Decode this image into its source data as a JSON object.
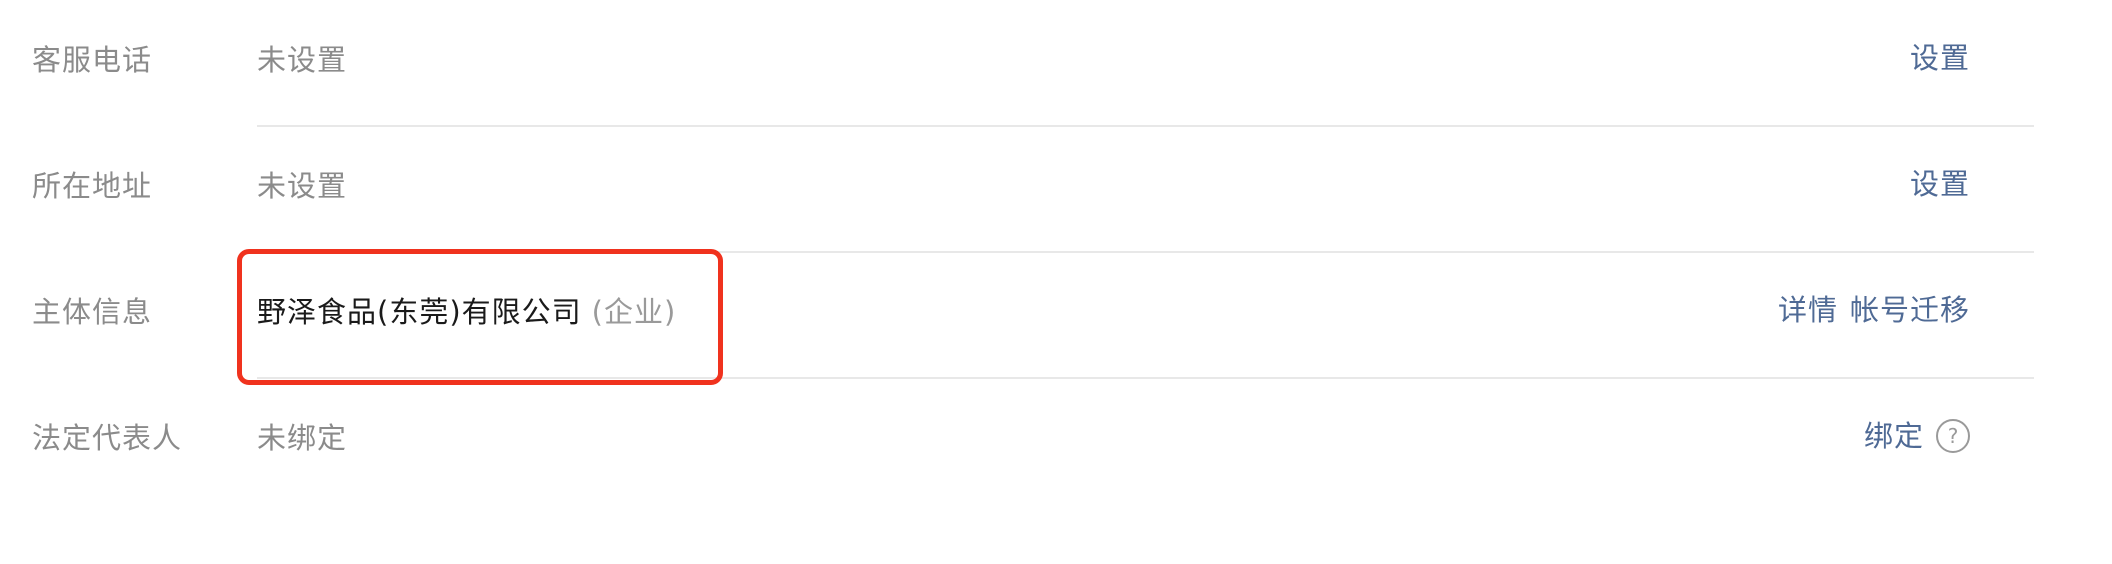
{
  "rows": [
    {
      "label": "客服电话",
      "value": "未设置",
      "actions": [
        "设置"
      ]
    },
    {
      "label": "所在地址",
      "value": "未设置",
      "actions": [
        "设置"
      ]
    },
    {
      "label": "主体信息",
      "value": "野泽食品(东莞)有限公司",
      "value_suffix": "(企业)",
      "actions": [
        "详情",
        "帐号迁移"
      ]
    },
    {
      "label": "法定代表人",
      "value": "未绑定",
      "actions": [
        "绑定"
      ],
      "help_icon": "?"
    }
  ],
  "colors": {
    "label": "#8b8b8b",
    "primary_text": "#1a1a1a",
    "link": "#4f6a95",
    "divider": "#e8e8e8",
    "highlight": "#f0321e"
  },
  "icons": {
    "help": "question-circle-icon"
  }
}
